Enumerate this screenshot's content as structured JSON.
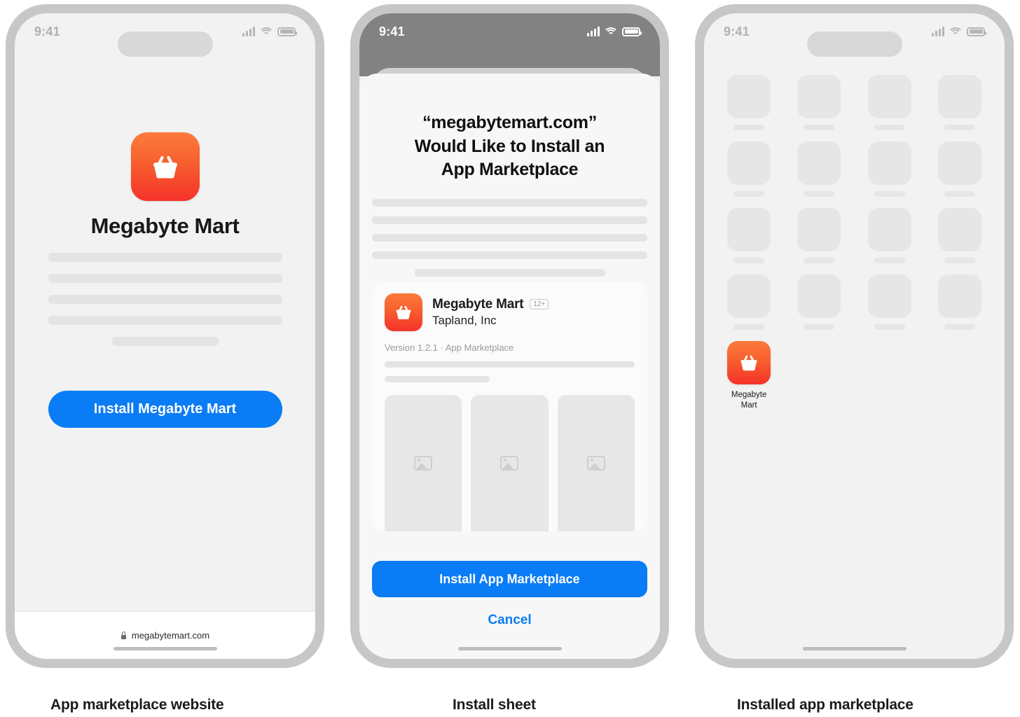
{
  "status_bar": {
    "time": "9:41",
    "icons": [
      "cellular-signal-icon",
      "wifi-icon",
      "battery-icon"
    ]
  },
  "theme": {
    "accent_blue": "#0a7cf5",
    "icon_gradient_top": "#fb7b3c",
    "icon_gradient_bottom": "#f5322a",
    "frame_grey": "#c7c7c7",
    "screen_bg": "#f2f2f2",
    "skeleton_grey": "#e4e4e4",
    "dim_overlay": "#828282"
  },
  "panels": [
    {
      "caption": "App marketplace website",
      "screen": {
        "app_icon_name": "shopping-basket-icon",
        "title": "Megabyte Mart",
        "install_button": "Install Megabyte Mart",
        "url": "megabytemart.com",
        "url_lock_icon": "lock-icon",
        "skeleton_lines": 4,
        "skeleton_short_line": true
      }
    },
    {
      "caption": "Install sheet",
      "screen": {
        "sheet_title": "“megabytemart.com” Would Like to Install an App Marketplace",
        "sheet_title_lines": [
          "“megabytemart.com”",
          "Would Like to Install an",
          "App Marketplace"
        ],
        "skeleton_lines": 4,
        "skeleton_short_line": true,
        "app_card": {
          "icon_name": "shopping-basket-icon",
          "name": "Megabyte Mart",
          "age_rating": "12+",
          "developer": "Tapland, Inc",
          "meta": "Version 1.2.1 · App Marketplace",
          "screenshot_count": 3,
          "screenshot_placeholder_icon": "image-placeholder-icon"
        },
        "primary_button": "Install App Marketplace",
        "cancel_button": "Cancel"
      }
    },
    {
      "caption": "Installed app marketplace",
      "screen": {
        "placeholder_app_rows": 4,
        "placeholder_app_columns": 4,
        "installed_app": {
          "icon_name": "shopping-basket-icon",
          "label": "Megabyte Mart",
          "label_lines": [
            "Megabyte",
            "Mart"
          ]
        }
      }
    }
  ]
}
